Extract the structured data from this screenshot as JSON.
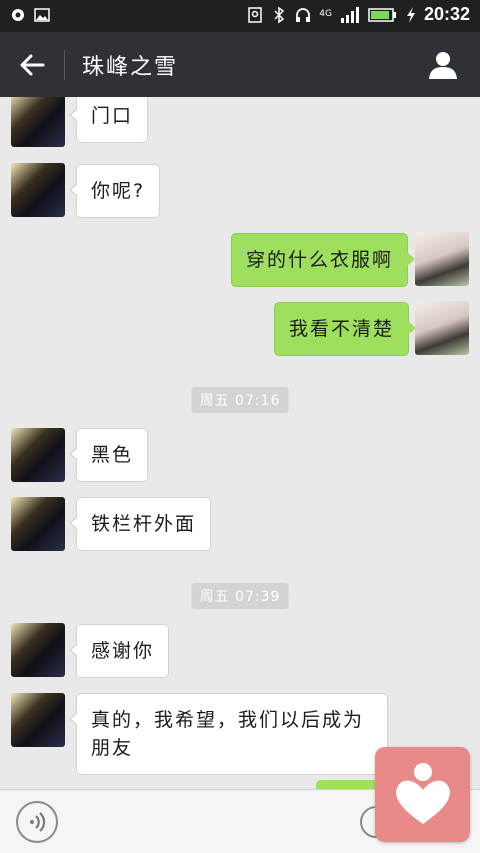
{
  "status_bar": {
    "time": "20:32",
    "network": "4G",
    "icons": [
      "notification-icon",
      "image-icon",
      "location-icon",
      "bluetooth-icon",
      "headset-icon",
      "signal-icon",
      "battery-icon",
      "charging-icon"
    ]
  },
  "header": {
    "title": "珠峰之雪",
    "back_icon": "arrow-left-icon",
    "profile_icon": "person-icon"
  },
  "messages": [
    {
      "side": "left",
      "text": "门口"
    },
    {
      "side": "left",
      "text": "你呢?"
    },
    {
      "side": "right",
      "text": "穿的什么衣服啊"
    },
    {
      "side": "right",
      "text": "我看不清楚"
    },
    {
      "type": "timestamp",
      "text": "周五 07:16"
    },
    {
      "side": "left",
      "text": "黑色"
    },
    {
      "side": "left",
      "text": "铁栏杆外面"
    },
    {
      "type": "timestamp",
      "text": "周五 07:39"
    },
    {
      "side": "left",
      "text": "感谢你"
    },
    {
      "side": "left",
      "text": "真的，我希望，我们以后成为朋友"
    }
  ],
  "input_bar": {
    "voice_icon": "voice-icon",
    "emoji_icon": "emoji-icon",
    "input_value": ""
  },
  "floating_widget": {
    "icon": "heart-person-icon"
  },
  "colors": {
    "header_bg": "#2e3236",
    "chat_bg": "#e9e9e9",
    "bubble_left": "#ffffff",
    "bubble_right": "#9ee05e",
    "widget": "#e88a8a"
  }
}
